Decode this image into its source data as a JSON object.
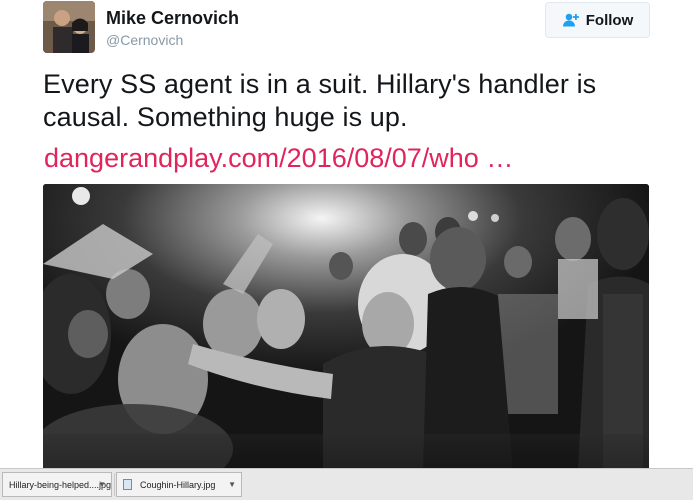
{
  "tweet": {
    "author_name": "Mike Cernovich",
    "author_handle": "@Cernovich",
    "follow_label": "Follow",
    "text": "Every SS agent is in a suit. Hillary's handler is causal. Something huge is up.",
    "link_text": "dangerandplay.com/2016/08/07/who  …"
  },
  "photo": {
    "icon": "crowd-photo"
  },
  "downloads": {
    "items": [
      {
        "filename": "Hillary-being-helped....jpg"
      },
      {
        "filename": "Coughin-Hillary.jpg"
      }
    ]
  },
  "colors": {
    "link": "#e0245e",
    "follow_icon": "#1da1f2"
  }
}
